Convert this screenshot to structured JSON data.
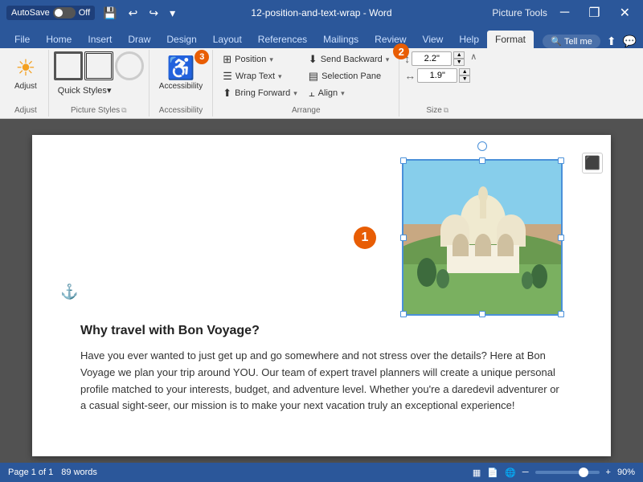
{
  "titlebar": {
    "autosave_label": "AutoSave",
    "autosave_state": "Off",
    "title": "12-position-and-text-wrap - Word",
    "picture_tools": "Picture Tools",
    "undo_icon": "↩",
    "redo_icon": "↪",
    "more_icon": "▾",
    "minimize_icon": "─",
    "restore_icon": "❐",
    "close_icon": "✕"
  },
  "tabs": [
    {
      "label": "File",
      "active": false
    },
    {
      "label": "Home",
      "active": false
    },
    {
      "label": "Insert",
      "active": false
    },
    {
      "label": "Draw",
      "active": false
    },
    {
      "label": "Design",
      "active": false
    },
    {
      "label": "Layout",
      "active": false
    },
    {
      "label": "References",
      "active": false
    },
    {
      "label": "Mailings",
      "active": false
    },
    {
      "label": "Review",
      "active": false
    },
    {
      "label": "View",
      "active": false
    },
    {
      "label": "Help",
      "active": false
    },
    {
      "label": "Format",
      "active": true,
      "highlight": false
    }
  ],
  "ribbon": {
    "adjust_group": {
      "label": "Adjust",
      "adjust_btn": "Adjust"
    },
    "picture_styles_group": {
      "label": "Picture Styles",
      "quick_styles": "Quick Styles",
      "quick_styles_icon": "▾"
    },
    "accessibility_group": {
      "label": "Accessibility",
      "btn_label": "Accessibility",
      "badge": "3"
    },
    "arrange_group": {
      "label": "Arrange",
      "position_btn": "Position",
      "wrap_text_btn": "Wrap Text",
      "bring_forward_btn": "Bring Forward",
      "send_backward_btn": "Send Backward",
      "selection_pane_btn": "Selection Pane",
      "align_btn": "Align",
      "dropdown": "▾"
    },
    "size_group": {
      "label": "Size",
      "height_value": "2.2\"",
      "width_value": "1.9\"",
      "badge": "2"
    },
    "collapse_icon": "∧"
  },
  "document": {
    "anchor": "⚓",
    "heading": "Why travel with Bon Voyage?",
    "body": "Have you ever wanted to just get up and go somewhere and not stress over the details?  Here at Bon Voyage we plan your trip around YOU. Our team of expert travel planners will create a unique personal profile matched to your interests, budget, and adventure level. Whether you're a daredevil adventurer or a casual sight-seer, our mission is to make your next vacation truly an exceptional experience!",
    "badge1": "1",
    "badge2": "2",
    "badge3": "3"
  },
  "statusbar": {
    "page_info": "Page 1 of 1",
    "word_count": "89 words",
    "layout_icon": "▦",
    "zoom_percent": "90%",
    "zoom_minus": "─",
    "zoom_plus": "+"
  }
}
